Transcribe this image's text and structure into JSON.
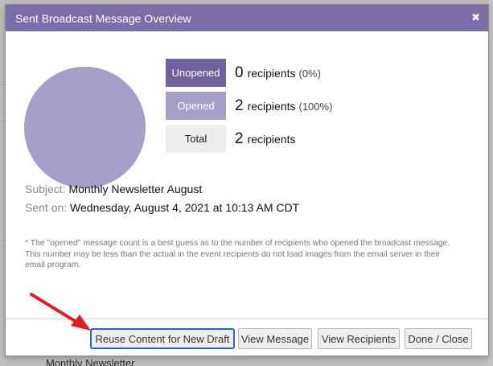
{
  "modal": {
    "title": "Sent Broadcast Message Overview",
    "close_symbol": "✖"
  },
  "stats": [
    {
      "label": "Unopened",
      "count": "0",
      "unit": "recipients",
      "percent": "(0%)"
    },
    {
      "label": "Opened",
      "count": "2",
      "unit": "recipients",
      "percent": "(100%)"
    },
    {
      "label": "Total",
      "count": "2",
      "unit": "recipients",
      "percent": ""
    }
  ],
  "chart_data": {
    "type": "pie",
    "categories": [
      "Unopened",
      "Opened"
    ],
    "values": [
      0,
      2
    ],
    "colors": [
      "#6f629d",
      "#a59fc8"
    ]
  },
  "details": {
    "subject_label": "Subject:",
    "subject_value": "Monthly Newsletter August",
    "sent_label": "Sent on:",
    "sent_value": "Wednesday, August 4, 2021 at 10:13 AM CDT"
  },
  "footnote": "* The \"opened\" message count is a best guess as to the number of recipients who opened the broadcast message. This number may be less than the actual in the event recipients do not load images from the email server in their email program.",
  "buttons": {
    "reuse": "Reuse Content for New Draft",
    "view_message": "View Message",
    "view_recipients": "View Recipients",
    "done_close": "Done / Close"
  },
  "background": {
    "peek_text": "Monthly Newsletter"
  },
  "colors": {
    "titlebar": "#7a6da8",
    "unopened": "#6f629d",
    "opened": "#a59fc8",
    "annotation_arrow": "#e02020",
    "focus_ring": "#2a64c5"
  }
}
